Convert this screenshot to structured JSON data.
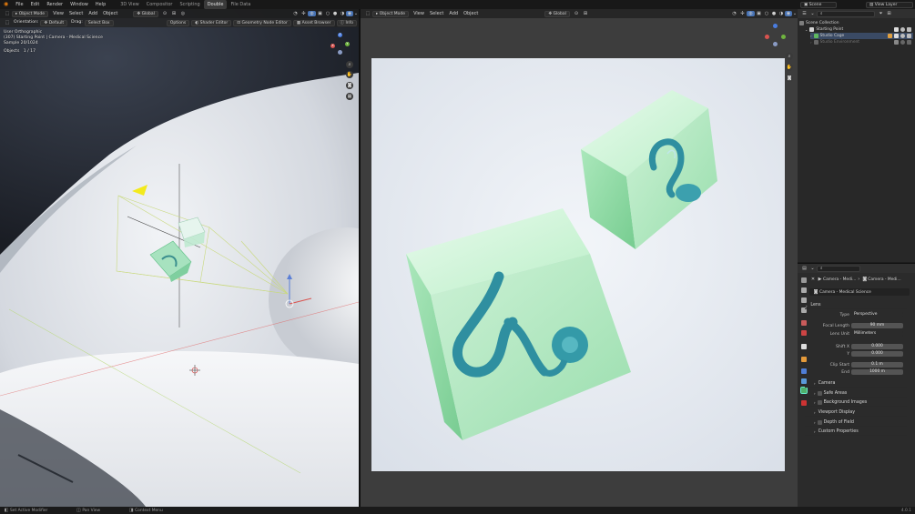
{
  "topbar": {
    "menus": [
      "File",
      "Edit",
      "Render",
      "Window",
      "Help"
    ],
    "tabs": [
      "3D View",
      "Compositor",
      "Scripting",
      "Double",
      "File Data"
    ],
    "active_tab": "Double",
    "scene_label": "Scene",
    "view_layer_label": "View Layer"
  },
  "left_viewport": {
    "mode": "Object Mode",
    "menus": [
      "View",
      "Select",
      "Add",
      "Object"
    ],
    "orientation_label": "Orientation:",
    "orientation_value": "Default",
    "drag_label": "Drag:",
    "drag_value": "Select Box",
    "transform": "Global",
    "options": "Options",
    "editor_tabs": [
      "Shader Editor",
      "Geometry Node Editor",
      "Asset Browser",
      "Info"
    ],
    "overlay_lines": [
      "User Orthographic",
      "(307) Starting Point | Camera - Medical Science",
      "Sample 20/1024"
    ],
    "objects_label": "Objects",
    "objects_value": "1 / 17",
    "gizmo_labels": [
      "Z",
      "Y",
      "X"
    ]
  },
  "right_viewport": {
    "mode": "Object Mode",
    "menus": [
      "View",
      "Select",
      "Add",
      "Object"
    ],
    "transform": "Global"
  },
  "outliner": {
    "search_placeholder": "",
    "rows": [
      {
        "label": "Scene Collection"
      },
      {
        "label": "Starting Point"
      },
      {
        "label": "Studio Cage"
      },
      {
        "label": "Studio Environment"
      }
    ]
  },
  "properties": {
    "breadcrumb": [
      "Camera - Medi...",
      "Camera - Medi..."
    ],
    "datablock": "Camera - Medical Science",
    "lens_header": "Lens",
    "fields": [
      {
        "label": "Type",
        "value": "Perspective",
        "kind": "drop"
      },
      {
        "label": "Focal Length",
        "value": "90 mm",
        "kind": "num"
      },
      {
        "label": "Lens Unit",
        "value": "Millimeters",
        "kind": "drop"
      },
      {
        "label": "Shift X",
        "value": "0.000",
        "kind": "num"
      },
      {
        "label": "Y",
        "value": "0.000",
        "kind": "num"
      },
      {
        "label": "Clip Start",
        "value": "0.1 m",
        "kind": "num"
      },
      {
        "label": "End",
        "value": "1000 m",
        "kind": "num"
      }
    ],
    "panels": [
      "Camera",
      "Safe Areas",
      "Background Images",
      "Viewport Display",
      "Depth of Field",
      "Custom Properties"
    ]
  },
  "statusbar": {
    "items": [
      "Set Active Modifier",
      "Pan View",
      "Context Menu"
    ],
    "version": "4.0.1"
  },
  "colors": {
    "accent": "#4772b3",
    "glass_green": "#8fe6a8",
    "teal": "#2f8fa0",
    "render_bg": "#e6ebf2"
  }
}
